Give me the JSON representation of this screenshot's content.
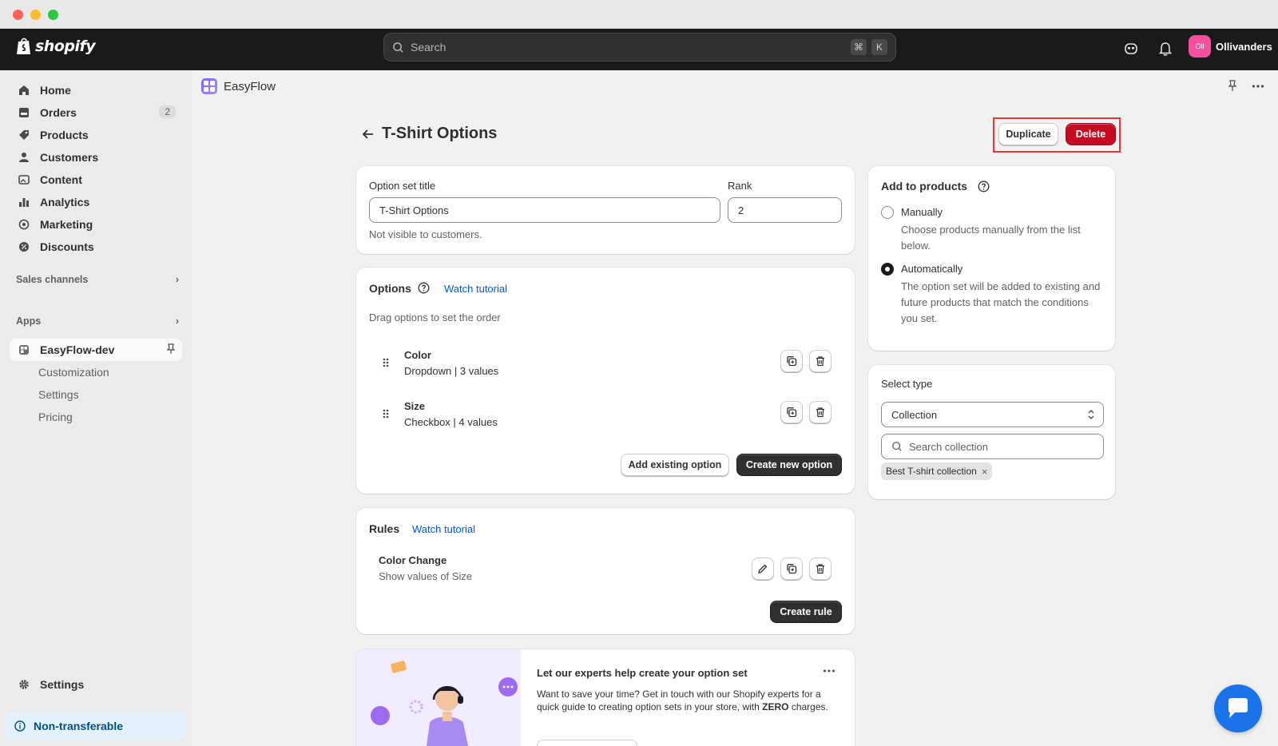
{
  "topbar": {
    "logo_text": "shopify",
    "search_placeholder": "Search",
    "shortcut_cmd": "⌘",
    "shortcut_key": "K",
    "store_initials": "Oll",
    "store_name": "Ollivanders"
  },
  "sidebar": {
    "items": [
      {
        "label": "Home",
        "icon": "home-icon"
      },
      {
        "label": "Orders",
        "icon": "orders-icon",
        "badge": "2"
      },
      {
        "label": "Products",
        "icon": "tag-icon"
      },
      {
        "label": "Customers",
        "icon": "person-icon"
      },
      {
        "label": "Content",
        "icon": "content-icon"
      },
      {
        "label": "Analytics",
        "icon": "chart-icon"
      },
      {
        "label": "Marketing",
        "icon": "target-icon"
      },
      {
        "label": "Discounts",
        "icon": "discount-icon"
      }
    ],
    "sales_channels": "Sales channels",
    "apps": "Apps",
    "active_app": "EasyFlow-dev",
    "app_subitems": [
      "Customization",
      "Settings",
      "Pricing"
    ],
    "settings": "Settings",
    "non_transferable": "Non-transferable"
  },
  "app_header": {
    "name": "EasyFlow"
  },
  "page": {
    "title": "T-Shirt Options",
    "duplicate_label": "Duplicate",
    "delete_label": "Delete"
  },
  "option_set": {
    "title_label": "Option set title",
    "title_value": "T-Shirt Options",
    "rank_label": "Rank",
    "rank_value": "2",
    "help": "Not visible to customers."
  },
  "options": {
    "title": "Options",
    "tutorial": "Watch tutorial",
    "hint": "Drag options to set the order",
    "items": [
      {
        "name": "Color",
        "detail": "Dropdown | 3 values"
      },
      {
        "name": "Size",
        "detail": "Checkbox | 4 values"
      }
    ],
    "add_existing": "Add existing option",
    "create_new": "Create new option"
  },
  "rules": {
    "title": "Rules",
    "tutorial": "Watch tutorial",
    "items": [
      {
        "name": "Color Change",
        "detail": "Show values of Size"
      }
    ],
    "create": "Create rule"
  },
  "add_to_products": {
    "title": "Add to products",
    "manual_label": "Manually",
    "manual_help": "Choose products manually from the list below.",
    "auto_label": "Automatically",
    "auto_help": "The option set will be added to existing and future products that match the conditions you set.",
    "selected": "Automatically"
  },
  "select_type": {
    "label": "Select type",
    "value": "Collection",
    "search_placeholder": "Search collection",
    "tags": [
      "Best T-shirt collection"
    ]
  },
  "promo": {
    "title": "Let our experts help create your option set",
    "body_prefix": "Want to save your time? Get in touch with our Shopify experts for a quick guide to creating option sets in your store, with ",
    "body_bold": "ZERO",
    "body_suffix": " charges."
  },
  "colors": {
    "accent": "#005bd3",
    "danger": "#c70a24",
    "dark": "#303030",
    "chat": "#1a73e8"
  }
}
